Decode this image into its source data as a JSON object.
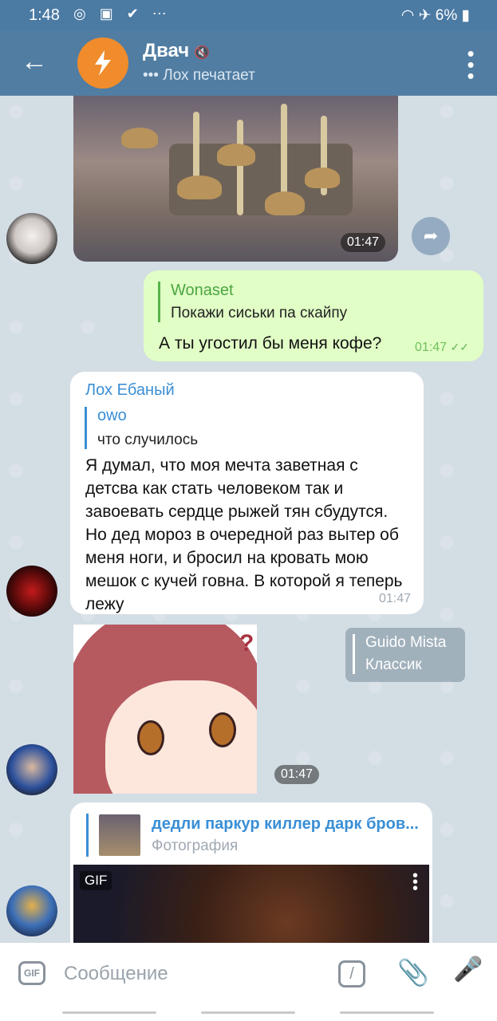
{
  "status": {
    "time": "1:48",
    "battery": "6%"
  },
  "header": {
    "title": "Двач",
    "subtitle": "Лох печатает"
  },
  "messages": {
    "photo_time": "01:47",
    "out": {
      "quote_name": "Wonaset",
      "quote_text": "Покажи сиськи па скайпу",
      "text": "А ты угостил бы меня кофе?",
      "time": "01:47"
    },
    "in1": {
      "sender": "Лох Ебаный",
      "quote_name": "owo",
      "quote_text": "что случилось",
      "text": "Я думал, что моя мечта заветная с детсва как стать человеком так и завоевать сердце рыжей тян сбудутся. Но дед мороз в очередной раз вытер об меня ноги, и бросил на кровать мою мешок с кучей говна. В которой я теперь лежу",
      "time": "01:47"
    },
    "sticker": {
      "time": "01:47",
      "reply_name": "Guido Mista",
      "reply_text": "Классик"
    },
    "in2": {
      "link_title": "дедли паркур киллер дарк бров...",
      "link_sub": "Фотография",
      "gif_label": "GIF"
    }
  },
  "input": {
    "placeholder": "Сообщение",
    "gif_button": "GIF"
  },
  "colors": {
    "header": "#517da2",
    "out_bubble": "#e1fec6",
    "accent": "#3a8fd6"
  }
}
